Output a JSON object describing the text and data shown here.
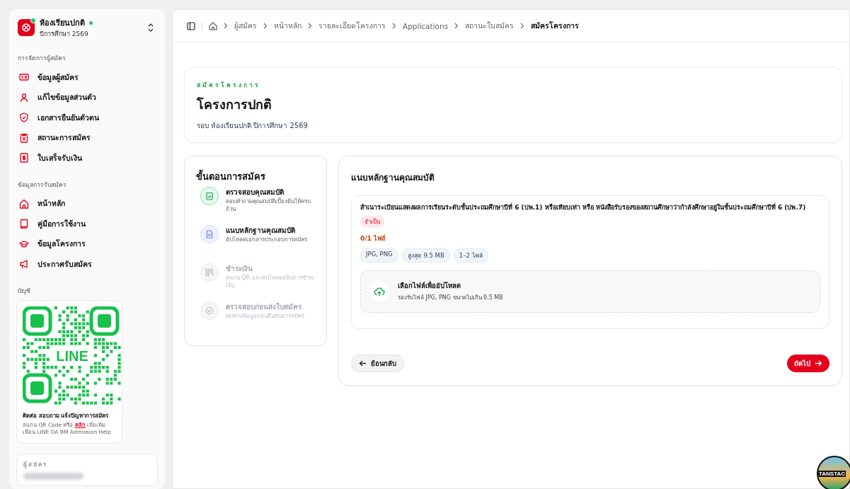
{
  "sidebar": {
    "org": {
      "name": "ห้องเรียนปกติ",
      "subtitle": "ปีการศึกษา 2569",
      "online": true
    },
    "sections": [
      {
        "label": "การจัดการผู้สมัคร",
        "items": [
          {
            "label": "ข้อมูลผู้สมัคร"
          },
          {
            "label": "แก้ไขข้อมูลส่วนตัว"
          },
          {
            "label": "เอกสารยืนยันตัวตน"
          },
          {
            "label": "สถานะการสมัคร"
          },
          {
            "label": "ใบเสร็จรับเงิน"
          }
        ]
      },
      {
        "label": "ข้อมูลการรับสมัคร",
        "items": [
          {
            "label": "หน้าหลัก"
          },
          {
            "label": "คู่มือการใช้งาน"
          },
          {
            "label": "ข้อมูลโครงการ"
          },
          {
            "label": "ประกาศรับสมัคร"
          }
        ]
      }
    ],
    "account": {
      "label": "บัญชี",
      "qr_text": "LINE",
      "contact_title": "ติดต่อ สอบถาม แจ้งปัญหาการสมัคร",
      "contact_before": "สแกน QR Code หรือ",
      "contact_link": "คลิก",
      "contact_after": "เพื่อเพิ่มเพื่อน LINE OA BM Admission Help"
    },
    "user": {
      "role": "ผู้สมัคร"
    }
  },
  "breadcrumbs": [
    {
      "label": "ผู้สมัคร",
      "current": false
    },
    {
      "label": "หน้าหลัก",
      "current": false
    },
    {
      "label": "รายละเอียดโครงการ",
      "current": false
    },
    {
      "label": "Applications",
      "current": false
    },
    {
      "label": "สถานะใบสมัคร",
      "current": false
    },
    {
      "label": "สมัครโครงการ",
      "current": true
    }
  ],
  "header": {
    "eyebrow": "สมัครโครงการ",
    "title": "โครงการปกติ",
    "subtitle": "รอบ ห้องเรียนปกติ ปีการศึกษา 2569"
  },
  "steps": {
    "title": "ขั้นตอนการสมัคร",
    "items": [
      {
        "title": "ตรวจสอบคุณสมบัติ",
        "description": "ตอบคำถามคุณสมบัติเบื้องต้นให้ครบถ้วน",
        "completed": true,
        "current": false
      },
      {
        "title": "แนบหลักฐานคุณสมบัติ",
        "description": "อัปโหลดเอกสารประกอบการสมัคร",
        "completed": false,
        "current": true
      },
      {
        "title": "ชำระเงิน",
        "description": "สแกน QR และอัปโหลดสลิปการชำระเงิน",
        "completed": false,
        "current": false
      },
      {
        "title": "ตรวจสอบก่อนส่งใบสมัคร",
        "description": "ทบทวนข้อมูลก่อนยืนยันการสมัคร",
        "completed": false,
        "current": false
      }
    ]
  },
  "upload": {
    "title": "แนบหลักฐานคุณสมบัติ",
    "document": {
      "name": "สำเนาระเบียนแสดงผลการเรียนระดับชั้นประถมศึกษาปีที่ 6 (ปพ.1) หรือเทียบเท่า หรือ หนังสือรับรองของสถานศึกษาว่ากำลังศึกษาอยู่ในชั้นประถมศึกษาปีที่ 6 (ปพ.7)",
      "required_badge": "จำเป็น",
      "count": "0/1 ไฟล์",
      "tags": [
        "JPG, PNG",
        "สูงสุด 9.5 MB",
        "1–2 ไฟล์"
      ],
      "dropzone_title": "เลือกไฟล์เพื่ออัปโหลด",
      "dropzone_hint": "รองรับไฟล์ JPG, PNG ขนาดไม่เกิน 9.5 MB"
    },
    "back_button": "ย้อนกลับ",
    "next_button": "ถัดไป"
  },
  "devtools_badge": "TANSTAC"
}
